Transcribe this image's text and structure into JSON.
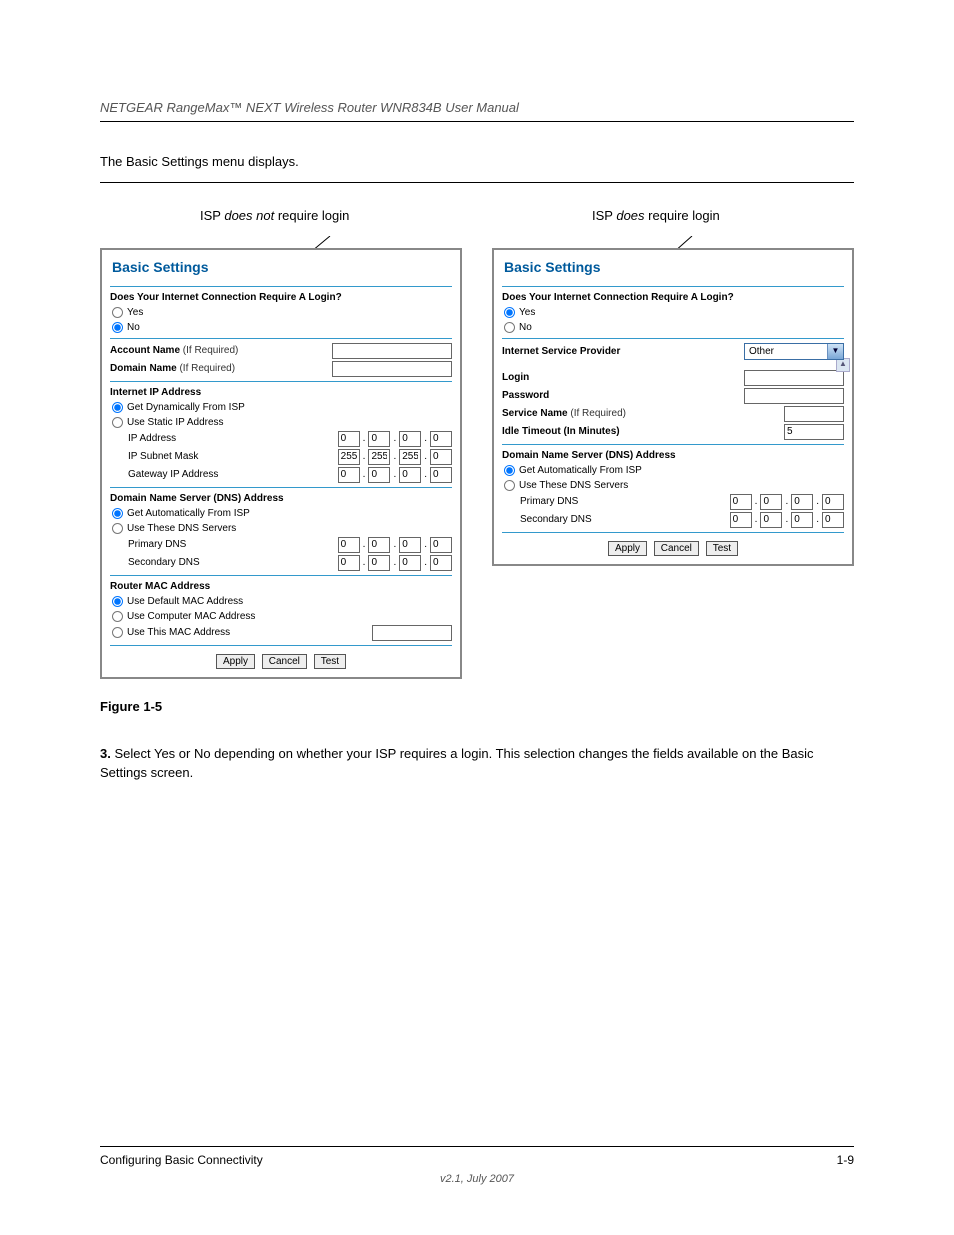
{
  "header": {
    "guide_title": "NETGEAR RangeMax™ NEXT Wireless Router WNR834B User Manual"
  },
  "intro": "The Basic Settings menu displays.",
  "columns": {
    "left_caption": "ISP does not require login",
    "right_caption": "ISP does require login"
  },
  "panel_title": "Basic Settings",
  "shared": {
    "login_question": "Does Your Internet Connection Require A Login?",
    "yes": "Yes",
    "no": "No",
    "dns_heading": "Domain Name Server (DNS) Address",
    "dns_auto": "Get Automatically From ISP",
    "dns_manual": "Use These DNS Servers",
    "primary_dns": "Primary DNS",
    "secondary_dns": "Secondary DNS",
    "apply": "Apply",
    "cancel": "Cancel",
    "test": "Test",
    "if_required": " (If Required)"
  },
  "left": {
    "account_name": "Account Name",
    "domain_name": "Domain Name",
    "internet_ip_heading": "Internet IP Address",
    "ip_dynamic": "Get Dynamically From ISP",
    "ip_static": "Use Static IP Address",
    "ip_address": "IP Address",
    "ip_subnet": "IP Subnet Mask",
    "gateway": "Gateway IP Address",
    "mac_heading": "Router MAC Address",
    "mac_default": "Use Default MAC Address",
    "mac_computer": "Use Computer MAC Address",
    "mac_this": "Use This MAC Address",
    "ip_zero": "0",
    "mask_255": "255"
  },
  "right": {
    "isp_label": "Internet Service Provider",
    "isp_value": "Other",
    "login": "Login",
    "password": "Password",
    "service_name": "Service Name",
    "idle_timeout": "Idle Timeout (In Minutes)",
    "idle_value": "5",
    "ip_zero": "0"
  },
  "figure": {
    "caption": "Figure 1-5"
  },
  "body": "3. Select Yes or No depending on whether your ISP requires a login. This selection changes the fields available on the Basic Settings screen.",
  "footer": {
    "left": "Configuring Basic Connectivity",
    "right": "1-9",
    "version": "v2.1, July 2007"
  }
}
